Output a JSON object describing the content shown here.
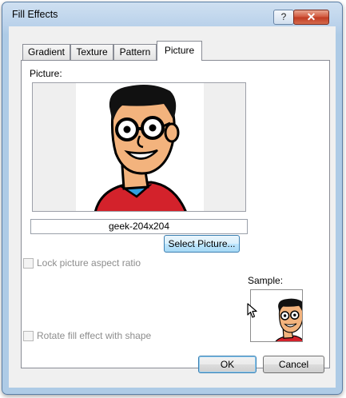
{
  "window": {
    "title": "Fill Effects",
    "help_glyph": "?",
    "close_glyph": "✕"
  },
  "tabs": [
    "Gradient",
    "Texture",
    "Pattern",
    "Picture"
  ],
  "active_tab": "Picture",
  "picture": {
    "label": "Picture:",
    "file_name": "geek-204x204",
    "select_button": "Select Picture..."
  },
  "options": {
    "lock_aspect_label": "Lock picture aspect ratio",
    "lock_aspect_checked": false,
    "rotate_label": "Rotate fill effect with shape",
    "rotate_checked": false
  },
  "sample": {
    "label": "Sample:"
  },
  "buttons": {
    "ok": "OK",
    "cancel": "Cancel"
  },
  "icons": {
    "picture": "geek-cartoon-image",
    "cursor": "mouse-pointer-icon"
  }
}
